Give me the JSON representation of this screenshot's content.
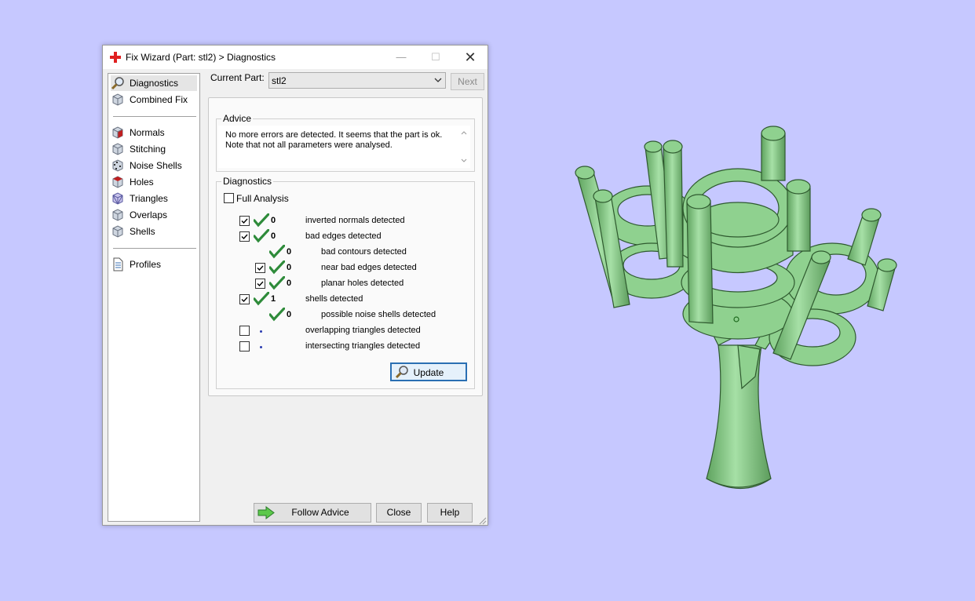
{
  "window": {
    "title": "Fix Wizard (Part: stl2) > Diagnostics",
    "min_glyph": "—",
    "max_glyph": "☐",
    "close_glyph": "✕"
  },
  "sidebar": {
    "items": [
      {
        "label": "Diagnostics",
        "icon": "magnifier-icon",
        "selected": true
      },
      {
        "label": "Combined Fix",
        "icon": "cube-icon"
      },
      {
        "label": "Normals",
        "icon": "normals-cube-icon"
      },
      {
        "label": "Stitching",
        "icon": "stitching-cube-icon"
      },
      {
        "label": "Noise Shells",
        "icon": "noise-cube-icon"
      },
      {
        "label": "Holes",
        "icon": "holes-cube-icon"
      },
      {
        "label": "Triangles",
        "icon": "triangles-cube-icon"
      },
      {
        "label": "Overlaps",
        "icon": "overlaps-cube-icon"
      },
      {
        "label": "Shells",
        "icon": "shells-cube-icon"
      },
      {
        "label": "Profiles",
        "icon": "document-icon"
      }
    ]
  },
  "header": {
    "current_part_label": "Current Part:",
    "current_part_value": "stl2",
    "next_label": "Next"
  },
  "advice": {
    "title": "Advice",
    "line1": "No more errors are detected. It seems that the part is ok.",
    "line2": "Note that not all parameters were analysed."
  },
  "diagnostics": {
    "title": "Diagnostics",
    "full_analysis_label": "Full Analysis",
    "full_analysis_checked": false,
    "rows": [
      {
        "label": "inverted normals detected",
        "count": "0",
        "checked": true,
        "status": "ok"
      },
      {
        "label": "bad edges detected",
        "count": "0",
        "checked": true,
        "status": "ok"
      },
      {
        "label": "bad contours detected",
        "count": "0",
        "status": "ok"
      },
      {
        "label": "near bad edges detected",
        "count": "0",
        "checked": true,
        "status": "ok"
      },
      {
        "label": "planar holes detected",
        "count": "0",
        "checked": true,
        "status": "ok"
      },
      {
        "label": "shells detected",
        "count": "1",
        "checked": true,
        "status": "ok"
      },
      {
        "label": "possible noise shells detected",
        "count": "0",
        "status": "ok"
      },
      {
        "label": "overlapping triangles detected",
        "count": "",
        "checked": false,
        "status": "not-analysed"
      },
      {
        "label": "intersecting triangles detected",
        "count": "",
        "checked": false,
        "status": "not-analysed"
      }
    ],
    "update_label": "Update"
  },
  "footer": {
    "follow_advice_label": "Follow Advice",
    "close_label": "Close",
    "help_label": "Help"
  },
  "colors": {
    "background": "#c6c8ff",
    "model_green": "#8fd18f",
    "check_green": "#2e8b3a",
    "accent_blue": "#2a6fb3"
  }
}
